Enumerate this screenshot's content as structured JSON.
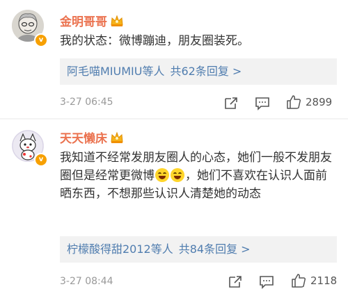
{
  "comments": [
    {
      "author": "金明哥哥",
      "text": "我的状态：微博蹦迪，朋友圈装死。",
      "reply_names": "阿毛喵MIUMIU等人",
      "reply_count": "共62条回复 >",
      "time": "3-27 06:45",
      "likes": "2899"
    },
    {
      "author": "天天懒床",
      "text_part1": "我知道不经常发朋友圈人的心态，她们一般不发朋友圈但是经常更微博",
      "text_part2": "，她们不喜欢在认识人面前晒东西，不想那些认识人清楚她的动态",
      "reply_names": "柠檬酸得甜2012等人",
      "reply_count": "共84条回复 >",
      "time": "3-27 08:44",
      "likes": "2118"
    }
  ],
  "colors": {
    "author": "#eb7350",
    "link": "#507daf",
    "meta": "#999999",
    "badge": "#f7a000"
  },
  "icons": [
    "crown-icon",
    "verified-badge-icon",
    "forward-icon",
    "comment-icon",
    "like-icon",
    "laugh-emoji-icon"
  ]
}
